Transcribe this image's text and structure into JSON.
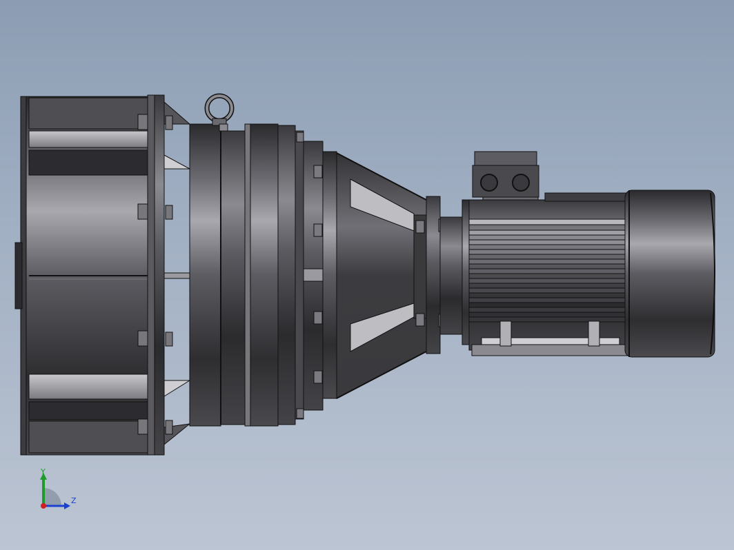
{
  "viewport": {
    "background_top": "#8c9db3",
    "background_bottom": "#bcc5d3"
  },
  "model": {
    "subject": "gear-reducer-with-electric-motor",
    "body_color": "#4a4a4e",
    "highlight_color": "#9a9aa0",
    "edge_color": "#111111"
  },
  "triad": {
    "y_label": "Y",
    "z_label": "Z",
    "y_color": "#1f9a2c",
    "z_color": "#1b3fd0",
    "x_color": "#d02020"
  }
}
